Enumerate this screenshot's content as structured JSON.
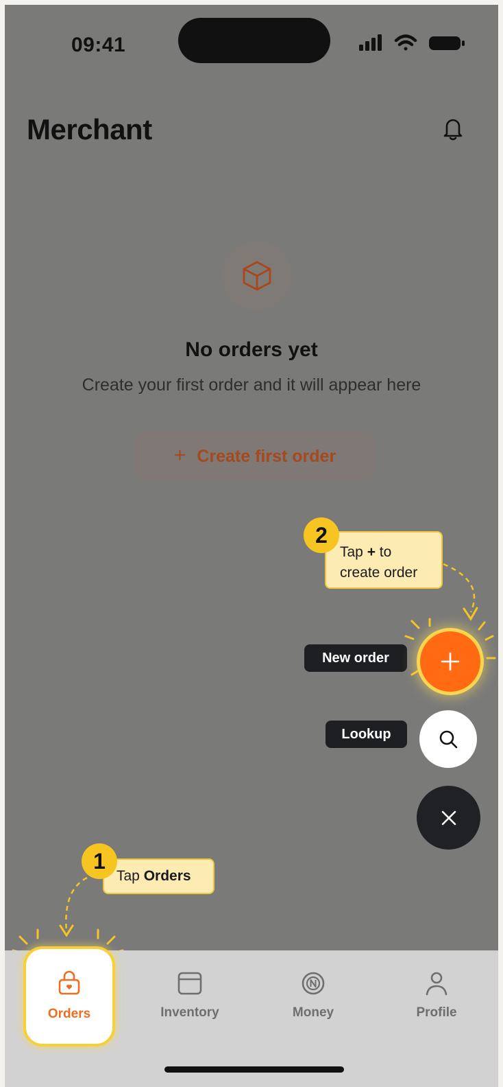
{
  "status_bar": {
    "time": "09:41"
  },
  "header": {
    "title": "Merchant",
    "icons": [
      "bell-icon"
    ]
  },
  "empty_state": {
    "icon": "box-icon",
    "title": "No orders yet",
    "subtitle": "Create your first order and it will appear here",
    "create_button": {
      "icon": "+",
      "label": "Create first order"
    }
  },
  "coachmarks": [
    {
      "step": "1",
      "text_prefix": "Tap ",
      "text_bold": "Orders"
    },
    {
      "step": "2",
      "line1_prefix": "Tap ",
      "line1_bold": "+",
      "line1_suffix": " to",
      "line2": "create order"
    }
  ],
  "fab_menu": {
    "actions": [
      {
        "label": "New order",
        "icon": "plus-icon"
      },
      {
        "label": "Lookup",
        "icon": "search-icon"
      }
    ],
    "close_icon": "close-icon"
  },
  "tab_bar": {
    "active": "Orders",
    "tabs": [
      {
        "label": "Orders",
        "icon": "lock-bag-icon"
      },
      {
        "label": "Inventory",
        "icon": "window-icon"
      },
      {
        "label": "Money",
        "icon": "coin-icon"
      },
      {
        "label": "Profile",
        "icon": "person-icon"
      }
    ]
  },
  "colors": {
    "accent": "#ff6a13",
    "highlight": "#f6c522",
    "callout_bg": "#fcebb3",
    "overlay": "#7a7a79",
    "dark": "#202124"
  }
}
